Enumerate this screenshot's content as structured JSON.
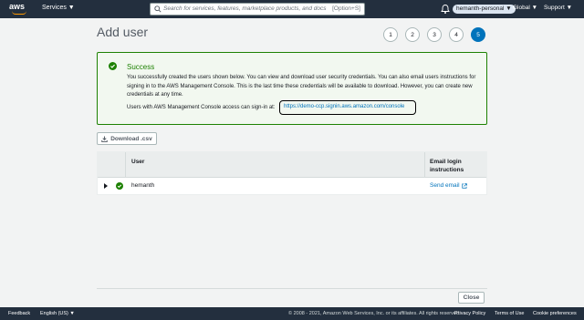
{
  "nav": {
    "logo": "aws",
    "services_label": "Services ▼",
    "search_placeholder": "Search for services, features, marketplace products, and docs",
    "search_shortcut": "[Option+S]",
    "account_label": "hemanth-personal ▼",
    "region_label": "Global ▼",
    "support_label": "Support ▼"
  },
  "page": {
    "title": "Add user",
    "steps": [
      "1",
      "2",
      "3",
      "4",
      "5"
    ],
    "active_step": "5"
  },
  "success": {
    "heading": "Success",
    "body": "You successfully created the users shown below. You can view and download user security credentials. You can also email users instructions for signing in to the AWS Management Console. This is the last time these credentials will be available to download. However, you can create new credentials at any time.",
    "signin_text": "Users with AWS Management Console access can sign-in at:",
    "signin_url": "https://demo-ccp.signin.aws.amazon.com/console"
  },
  "actions": {
    "download_label": "Download .csv",
    "close_label": "Close"
  },
  "table": {
    "col_user": "User",
    "col_email": "Email login instructions",
    "rows": [
      {
        "user": "hemanth",
        "email_action": "Send email"
      }
    ]
  },
  "footer": {
    "feedback": "Feedback",
    "language": "English (US) ▼",
    "copyright": "© 2008 - 2021, Amazon Web Services, Inc. or its affiliates. All rights reserved.",
    "privacy": "Privacy Policy",
    "terms": "Terms of Use",
    "cookies": "Cookie preferences"
  },
  "colors": {
    "nav_bg": "#232f3e",
    "success_border": "#1d8102",
    "link": "#0073bb",
    "brand_orange": "#ff9900"
  }
}
